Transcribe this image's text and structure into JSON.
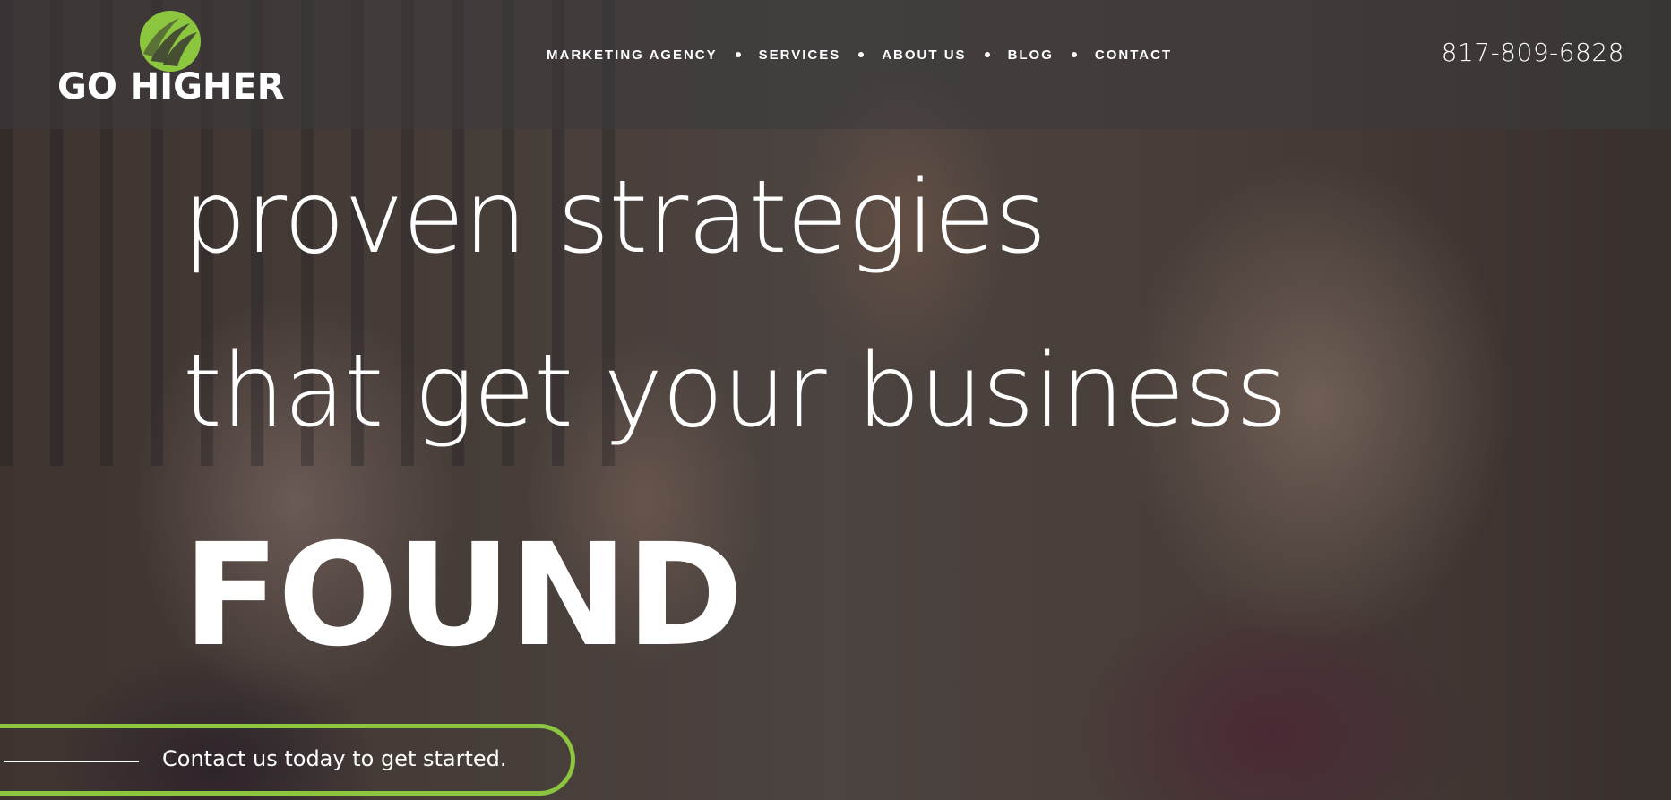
{
  "brand": {
    "name": "GO HIGHER",
    "accent_color": "#8cc63f",
    "logo_icon": "leaf-swoosh-icon"
  },
  "nav": {
    "items": [
      {
        "label": "MARKETING AGENCY"
      },
      {
        "label": "SERVICES"
      },
      {
        "label": "ABOUT US"
      },
      {
        "label": "BLOG"
      },
      {
        "label": "CONTACT"
      }
    ]
  },
  "header": {
    "phone": "817-809-6828"
  },
  "hero": {
    "line1": "proven strategies",
    "line2": "that get your business",
    "line3": "FOUND"
  },
  "cta": {
    "label": "Contact us today to get started."
  }
}
